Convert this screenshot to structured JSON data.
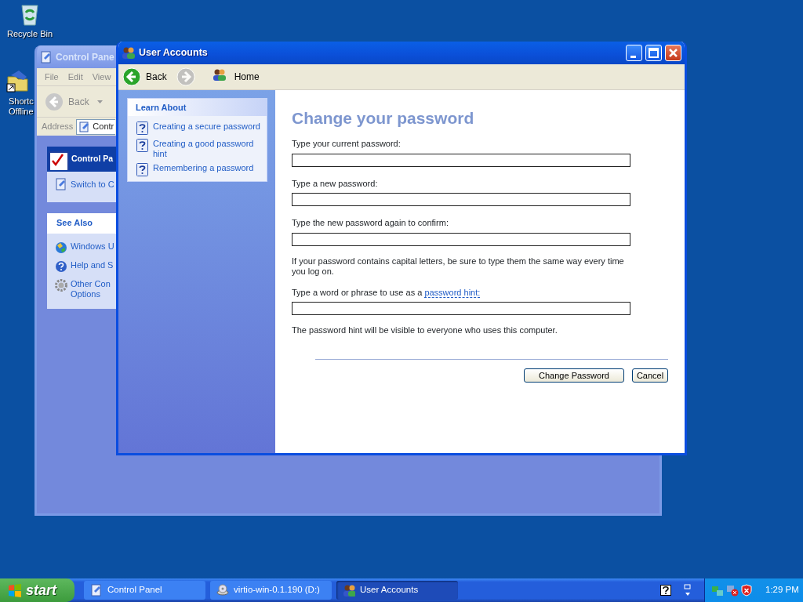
{
  "desktop_icons": [
    {
      "kind": "recycle",
      "lines": [
        "Recycle Bin"
      ]
    },
    {
      "kind": "shortcut",
      "lines": [
        "Shortc",
        "Offline"
      ]
    }
  ],
  "control_panel": {
    "title": "Control Pane",
    "menu": [
      "File",
      "Edit",
      "View"
    ],
    "back": "Back",
    "address_label": "Address",
    "address_value": "Contr",
    "panel_title": "Control Pa",
    "switch_link": "Switch to C",
    "see_also": {
      "title": "See Also",
      "items": [
        {
          "kind": "update",
          "label": "Windows U"
        },
        {
          "kind": "help",
          "label": "Help and S"
        },
        {
          "kind": "gear",
          "label": "Other Con Options"
        }
      ]
    }
  },
  "user_accounts": {
    "title": "User Accounts",
    "nav": [
      {
        "kind": "back",
        "label": "Back",
        "disabled": false
      },
      {
        "kind": "forward",
        "disabled": true
      },
      {
        "kind": "home",
        "label": "Home",
        "disabled": false
      }
    ],
    "learn_about": {
      "title": "Learn About",
      "links": [
        "Creating a secure password",
        "Creating a good password hint",
        "Remembering a password"
      ]
    },
    "heading": "Change your password",
    "fields": [
      {
        "label": "Type your current password:"
      },
      {
        "label": "Type a new password:"
      },
      {
        "label": "Type the new password again to confirm:"
      }
    ],
    "note": "If your password contains capital letters, be sure to type them the same way every time you log on.",
    "hint": {
      "text": "Type a word or phrase to use as a ",
      "link": "password hint:"
    },
    "footnote": "The password hint will be visible to everyone who uses this computer.",
    "buttons": [
      {
        "label": "Change Password"
      },
      {
        "label": "Cancel"
      }
    ]
  },
  "taskbar": {
    "start": "start",
    "tasks": [
      {
        "kind": "panel",
        "label": "Control Panel",
        "selected": false
      },
      {
        "kind": "disc",
        "label": "virtio-win-0.1.190 (D:)",
        "selected": false
      },
      {
        "kind": "users",
        "label": "User Accounts",
        "selected": true
      }
    ],
    "time": "1:29 PM"
  }
}
